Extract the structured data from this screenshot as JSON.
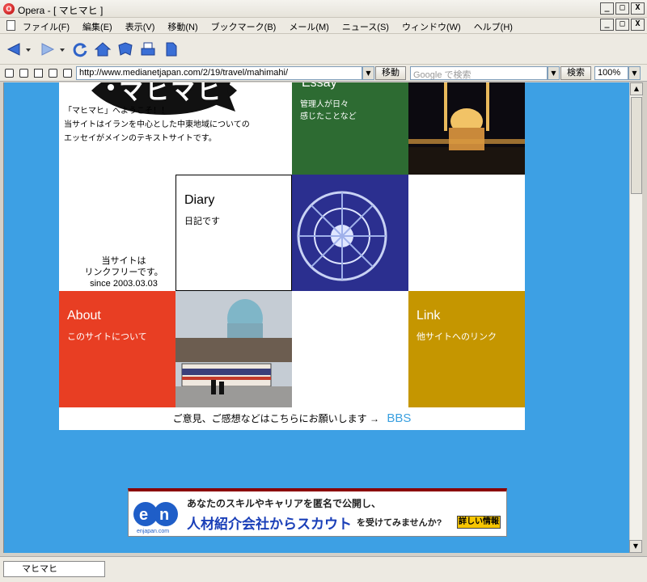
{
  "window": {
    "title": "Opera - [ マヒマヒ ]",
    "min": "_",
    "max": "□",
    "close": "X"
  },
  "menu": [
    "ファイル(F)",
    "編集(E)",
    "表示(V)",
    "移動(N)",
    "ブックマーク(B)",
    "メール(M)",
    "ニュース(S)",
    "ウィンドウ(W)",
    "ヘルプ(H)"
  ],
  "address": {
    "url": "http://www.medianetjapan.com/2/19/travel/mahimahi/",
    "go_label": "移動",
    "search_placeholder": "Google で検索",
    "search_label": "検索",
    "zoom": "100%"
  },
  "site": {
    "logo_text": "マヒマヒ",
    "intro": "「マヒマヒ」へようこそ！！\n当サイトはイランを中心とした中東地域についての\nエッセイがメインのテキストサイトです。",
    "essay_title": "Essay",
    "essay_sub": "管理人が日々\n感じたことなど",
    "diary_title": "Diary",
    "diary_sub": "日記です",
    "linkfree": "当サイトは\nリンクフリーです。\nsince 2003.03.03",
    "about_title": "About",
    "about_sub": "このサイトについて",
    "link_title": "Link",
    "link_sub": "他サイトへのリンク",
    "footer_text": "ご意見、ご感想などはこちらにお願いします →",
    "bbs": "BBS"
  },
  "banner": {
    "brand": "en",
    "brand_sub": "enjapan.com",
    "line1": "あなたのスキルやキャリアを匿名で公開し、",
    "line2": "人材紹介会社からスカウト",
    "line2b": "を受けてみませんか?",
    "more": "詳しい情報"
  },
  "status": {
    "tab_title": "マヒマヒ"
  }
}
